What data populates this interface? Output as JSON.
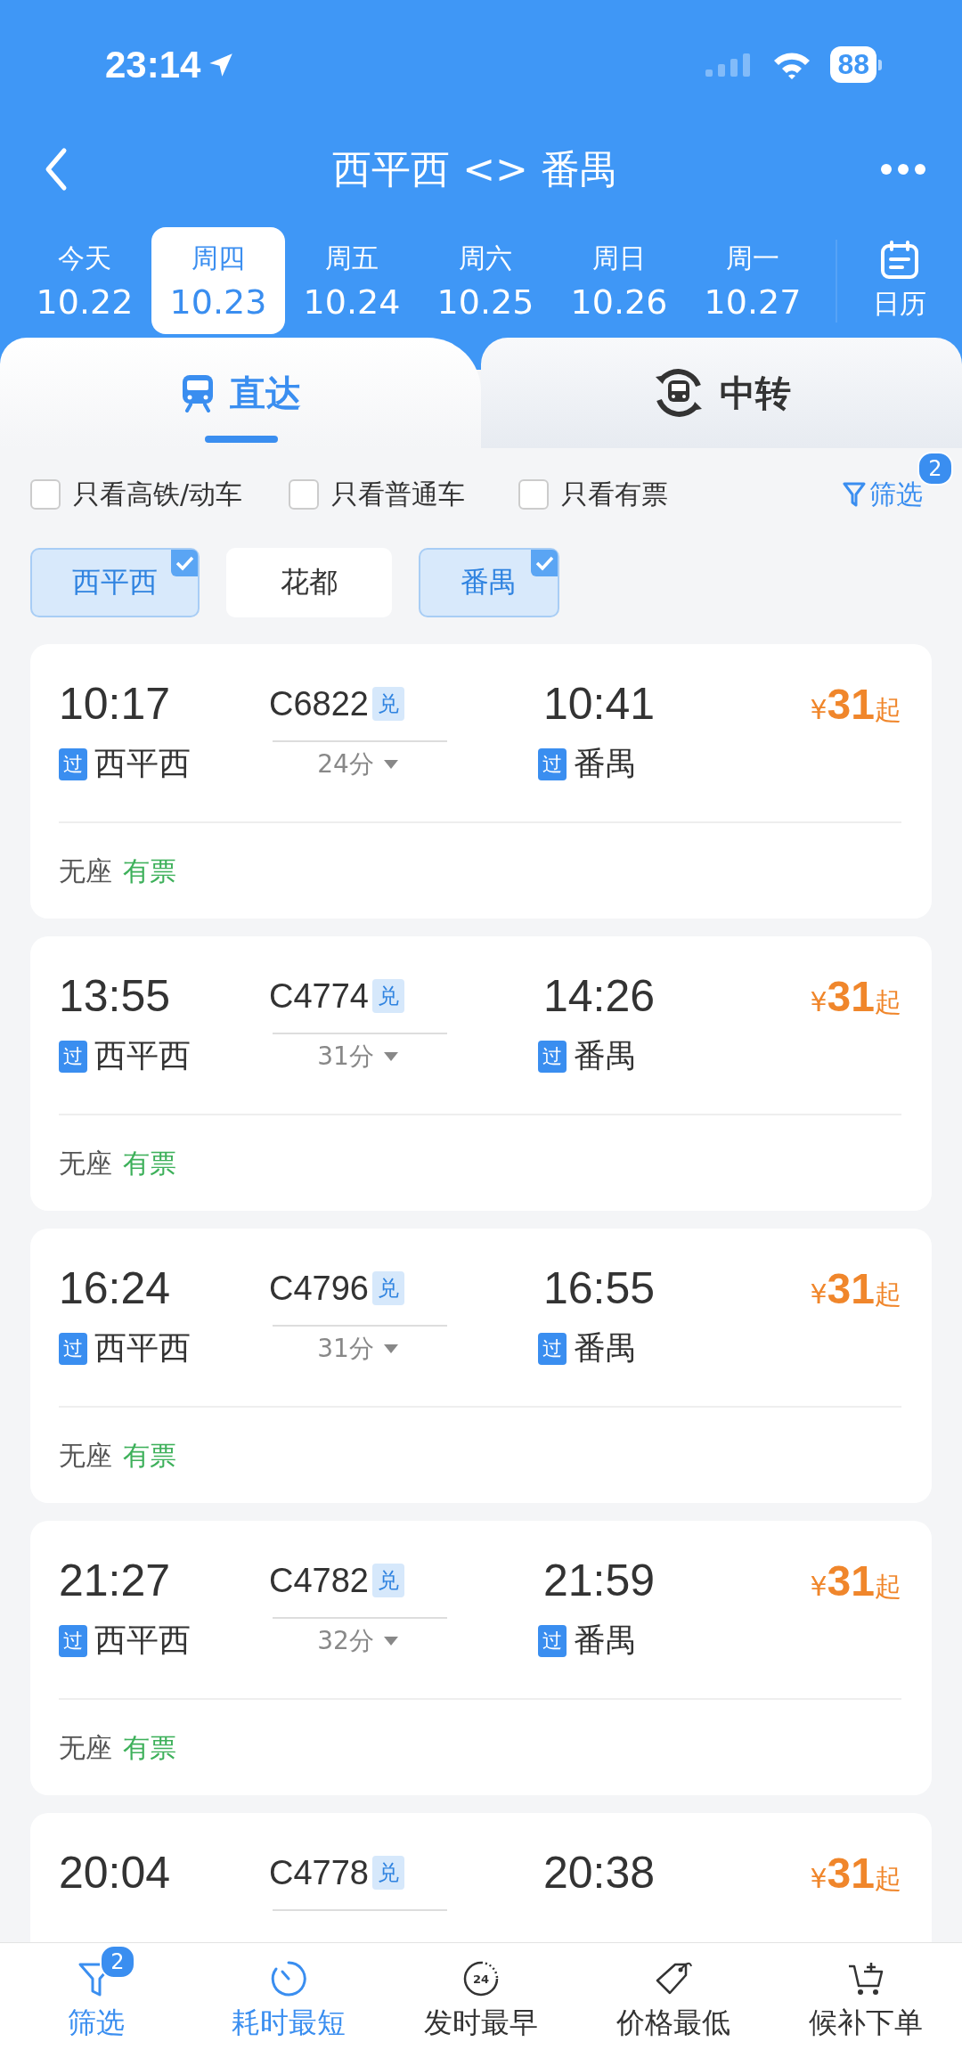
{
  "status_bar": {
    "time": "23:14",
    "battery": "88"
  },
  "nav": {
    "title": "西平西 <> 番禺"
  },
  "dates": [
    {
      "weekday": "今天",
      "date": "10.22",
      "selected": false
    },
    {
      "weekday": "周四",
      "date": "10.23",
      "selected": true
    },
    {
      "weekday": "周五",
      "date": "10.24",
      "selected": false
    },
    {
      "weekday": "周六",
      "date": "10.25",
      "selected": false
    },
    {
      "weekday": "周日",
      "date": "10.26",
      "selected": false
    },
    {
      "weekday": "周一",
      "date": "10.27",
      "selected": false
    }
  ],
  "calendar": {
    "label": "日历"
  },
  "tabs": [
    {
      "label": "直达",
      "kind": "direct",
      "selected": true
    },
    {
      "label": "中转",
      "kind": "transfer",
      "selected": false
    }
  ],
  "filters": [
    {
      "label": "只看高铁/动车",
      "checked": false
    },
    {
      "label": "只看普通车",
      "checked": false
    },
    {
      "label": "只看有票",
      "checked": false
    }
  ],
  "filter_button": {
    "label": "筛选",
    "badge": "2"
  },
  "stations": [
    {
      "label": "西平西",
      "selected": true
    },
    {
      "label": "花都",
      "selected": false
    },
    {
      "label": "番禺",
      "selected": true
    }
  ],
  "trains": [
    {
      "depart": "10:17",
      "train_no": "C6822",
      "tag": "兑",
      "arrive": "10:41",
      "currency": "¥",
      "price": "31",
      "price_suffix": "起",
      "from_tag": "过",
      "from": "西平西",
      "duration": "24分",
      "to_tag": "过",
      "to": "番禺",
      "seat": "无座",
      "availability": "有票"
    },
    {
      "depart": "13:55",
      "train_no": "C4774",
      "tag": "兑",
      "arrive": "14:26",
      "currency": "¥",
      "price": "31",
      "price_suffix": "起",
      "from_tag": "过",
      "from": "西平西",
      "duration": "31分",
      "to_tag": "过",
      "to": "番禺",
      "seat": "无座",
      "availability": "有票"
    },
    {
      "depart": "16:24",
      "train_no": "C4796",
      "tag": "兑",
      "arrive": "16:55",
      "currency": "¥",
      "price": "31",
      "price_suffix": "起",
      "from_tag": "过",
      "from": "西平西",
      "duration": "31分",
      "to_tag": "过",
      "to": "番禺",
      "seat": "无座",
      "availability": "有票"
    },
    {
      "depart": "21:27",
      "train_no": "C4782",
      "tag": "兑",
      "arrive": "21:59",
      "currency": "¥",
      "price": "31",
      "price_suffix": "起",
      "from_tag": "过",
      "from": "西平西",
      "duration": "32分",
      "to_tag": "过",
      "to": "番禺",
      "seat": "无座",
      "availability": "有票"
    },
    {
      "depart": "20:04",
      "train_no": "C4778",
      "tag": "兑",
      "arrive": "20:38",
      "currency": "¥",
      "price": "31",
      "price_suffix": "起"
    }
  ],
  "bottom_nav": [
    {
      "label": "筛选",
      "kind": "filter",
      "badge": "2",
      "active": true
    },
    {
      "label": "耗时最短",
      "kind": "duration",
      "active": true
    },
    {
      "label": "发时最早",
      "kind": "earliest",
      "icon_text": "24",
      "active": false
    },
    {
      "label": "价格最低",
      "kind": "price",
      "active": false
    },
    {
      "label": "候补下单",
      "kind": "waitlist",
      "active": false
    }
  ]
}
